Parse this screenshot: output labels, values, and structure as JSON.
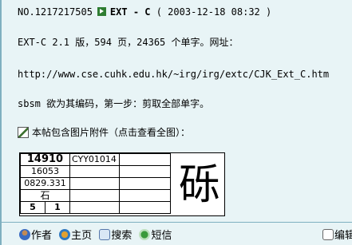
{
  "post": {
    "header": {
      "number": "NO.1217217505",
      "author": "EXT - C",
      "timestamp": "( 2003-12-18 08:32 )"
    },
    "lines": {
      "line1": "EXT-C  2.1 版，594 页，24365 个单字。网址：",
      "line2": "http://www.cse.cuhk.edu.hk/~irg/irg/extc/CJK_Ext_C.htm",
      "line3": "sbsm 欲为其编码，第一步：剪取全部单字。",
      "attachment": "本帖包含图片附件（点击查看全图）："
    },
    "glyph_card": {
      "code": "14910",
      "ref": "CYY01014",
      "num2": "16053",
      "num3": "0829.331",
      "radical": "石",
      "stroke_a": "5",
      "stroke_b": "1",
      "character": "砾"
    }
  },
  "toolbar": {
    "author_label": "作者",
    "home_label": "主页",
    "search_label": "搜索",
    "message_label": "短信",
    "edit_label": "编辑"
  }
}
